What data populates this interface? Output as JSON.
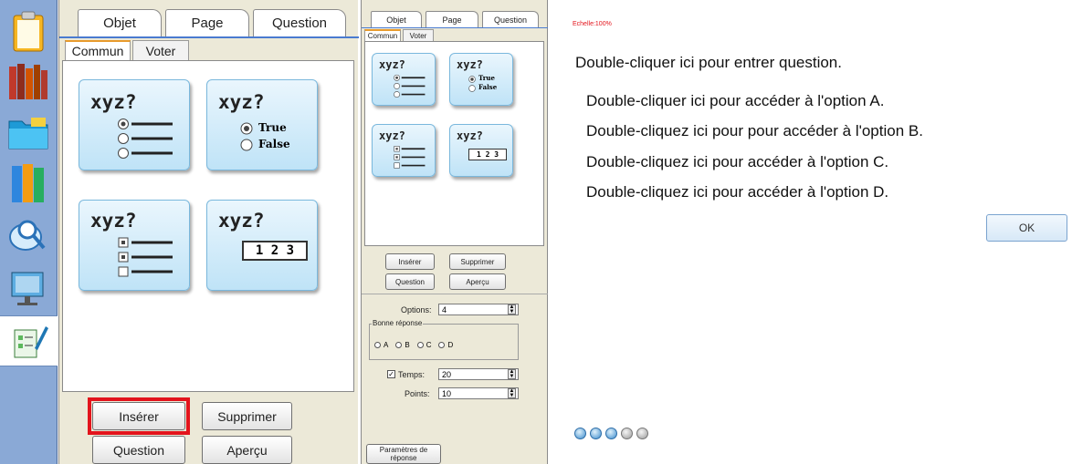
{
  "toolbar": {
    "icons": [
      "clipboard-icon",
      "books-icon",
      "folder-icon",
      "binders-icon",
      "magnifier-icon",
      "presentation-icon",
      "quiz-edit-icon"
    ]
  },
  "big_panel": {
    "tabs": {
      "objet": "Objet",
      "page": "Page",
      "question": "Question"
    },
    "subtabs": {
      "commun": "Commun",
      "voter": "Voter"
    },
    "cards": [
      {
        "title": "xyz?",
        "kind": "multiple-choice"
      },
      {
        "title": "xyz?",
        "kind": "true-false",
        "true_label": "True",
        "false_label": "False"
      },
      {
        "title": "xyz?",
        "kind": "multiple-answer"
      },
      {
        "title": "xyz?",
        "kind": "numeric",
        "numbers": "1 2 3"
      }
    ],
    "buttons": {
      "inserer": "Insérer",
      "supprimer": "Supprimer",
      "question": "Question",
      "apercu": "Aperçu"
    },
    "highlight_color": "#e3141c"
  },
  "small_panel": {
    "tabs": {
      "objet": "Objet",
      "page": "Page",
      "question": "Question"
    },
    "subtabs": {
      "commun": "Commun",
      "voter": "Voter"
    },
    "cards": [
      {
        "title": "xyz?"
      },
      {
        "title": "xyz?",
        "true_label": "True",
        "false_label": "False"
      },
      {
        "title": "xyz?"
      },
      {
        "title": "xyz?",
        "numbers": "1 2 3"
      }
    ],
    "buttons": {
      "inserer": "Insérer",
      "supprimer": "Supprimer",
      "question": "Question",
      "apercu": "Aperçu"
    },
    "options_label": "Options:",
    "options_value": "4",
    "bonne_reponse_label": "Bonne réponse",
    "answer_options": [
      "A",
      "B",
      "C",
      "D"
    ],
    "temps_label": "Temps:",
    "temps_value": "20",
    "temps_checked": true,
    "points_label": "Points:",
    "points_value": "10",
    "parametres_button": "Paramètres de réponse"
  },
  "preview": {
    "scale_label": "Echelle:100%",
    "question_text": "Double-cliquer ici pour entrer question.",
    "options": [
      "Double-cliquer ici pour accéder à l'option A.",
      "Double-cliquez ici pour  pour accéder à l'option B.",
      "Double-cliquez ici pour accéder à l'option C.",
      "Double-cliquez ici pour accéder à l'option D."
    ],
    "ok_button": "OK",
    "nav_icons": [
      "nav-first-icon",
      "nav-prev-icon",
      "nav-play-icon",
      "nav-next-icon",
      "nav-last-icon"
    ]
  }
}
